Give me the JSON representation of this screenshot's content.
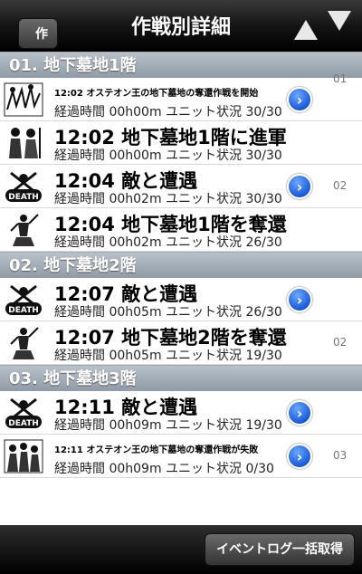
{
  "nav": {
    "back_label": "作戦状況",
    "title": "作戦別詳細"
  },
  "sections": [
    {
      "label": "01. 地下墓地1階",
      "rows": [
        {
          "title": "12:02 オステオン王の地下墓地の奪還作戦を開始",
          "small": true,
          "sub": "経過時間 00h00m ユニット状況 30/30",
          "icon": "map-scroll-icon",
          "disclosure": true
        },
        {
          "title": "12:02 地下墓地1階に進軍",
          "small": false,
          "sub": "経過時間 00h00m ユニット状況 30/30",
          "icon": "soldiers-icon",
          "disclosure": false
        },
        {
          "title": "12:04 敵と遭遇",
          "small": false,
          "sub": "経過時間 00h02m ユニット状況 30/30",
          "icon": "death-icon",
          "disclosure": true
        },
        {
          "title": "12:04 地下墓地1階を奪還",
          "small": false,
          "sub": "経過時間 00h02m ユニット状況 26/30",
          "icon": "victory-statue-icon",
          "disclosure": false
        }
      ]
    },
    {
      "label": "02. 地下墓地2階",
      "rows": [
        {
          "title": "12:07 敵と遭遇",
          "small": false,
          "sub": "経過時間 00h05m ユニット状況 26/30",
          "icon": "death-icon",
          "disclosure": true
        },
        {
          "title": "12:07 地下墓地2階を奪還",
          "small": false,
          "sub": "経過時間 00h05m ユニット状況 19/30",
          "icon": "victory-statue-icon",
          "disclosure": false
        }
      ]
    },
    {
      "label": "03. 地下墓地3階",
      "rows": [
        {
          "title": "12:11 敵と遭遇",
          "small": false,
          "sub": "経過時間 00h09m ユニット状況 19/30",
          "icon": "death-icon",
          "disclosure": true
        },
        {
          "title": "12:11 オステオン王の地下墓地の奪還作戦が失敗",
          "small": true,
          "sub": "経過時間 00h09m ユニット状況 0/30",
          "icon": "defeat-crowd-icon",
          "disclosure": true
        }
      ]
    }
  ],
  "index_markers": [
    "01",
    "02",
    "02",
    "03"
  ],
  "toolbar": {
    "fetch_label": "イベントログ一括取得"
  },
  "colors": {
    "section_bg": "#9aa5b0",
    "disclosure": "#2a6ae0"
  }
}
